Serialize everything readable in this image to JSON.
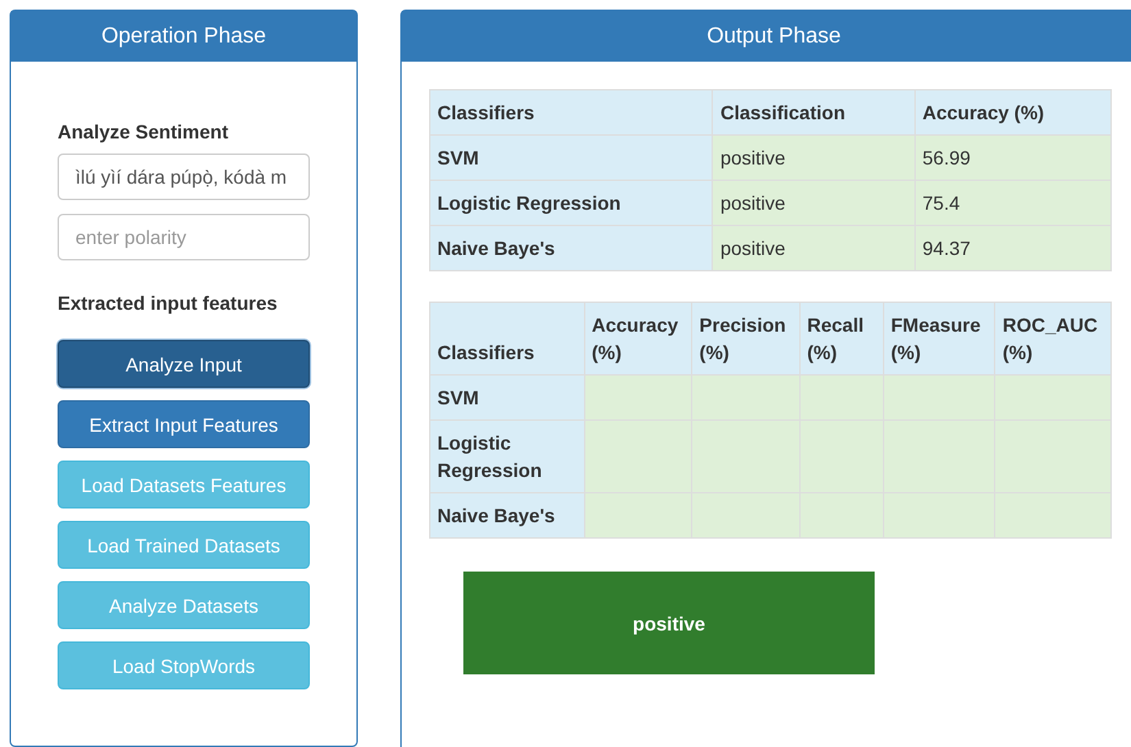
{
  "operation_panel": {
    "title": "Operation Phase",
    "sentiment_label": "Analyze Sentiment",
    "text_field": {
      "value": "ìlú yìí dára púpọ̀, kódà m"
    },
    "polarity_field": {
      "placeholder": "enter polarity"
    },
    "features_label": "Extracted input features",
    "buttons": [
      {
        "label": "Analyze Input",
        "kind": "active"
      },
      {
        "label": "Extract Input Features",
        "kind": "primary"
      },
      {
        "label": "Load Datasets Features",
        "kind": "info"
      },
      {
        "label": "Load Trained Datasets",
        "kind": "info"
      },
      {
        "label": "Analyze Datasets",
        "kind": "info"
      },
      {
        "label": "Load StopWords",
        "kind": "info"
      }
    ]
  },
  "output_panel": {
    "title": "Output Phase",
    "classification_table": {
      "columns": [
        "Classifiers",
        "Classification",
        "Accuracy (%)"
      ],
      "rows": [
        [
          "SVM",
          "positive",
          "56.99"
        ],
        [
          "Logistic Regression",
          "positive",
          "75.4"
        ],
        [
          "Naive Baye's",
          "positive",
          "94.37"
        ]
      ]
    },
    "metrics_table": {
      "columns": [
        "Classifiers",
        "Accuracy (%)",
        "Precision (%)",
        "Recall (%)",
        "FMeasure (%)",
        "ROC_AUC (%)"
      ],
      "rows": [
        [
          "SVM"
        ],
        [
          "Logistic Regression"
        ],
        [
          "Naive Baye's"
        ]
      ]
    },
    "result": "positive"
  }
}
